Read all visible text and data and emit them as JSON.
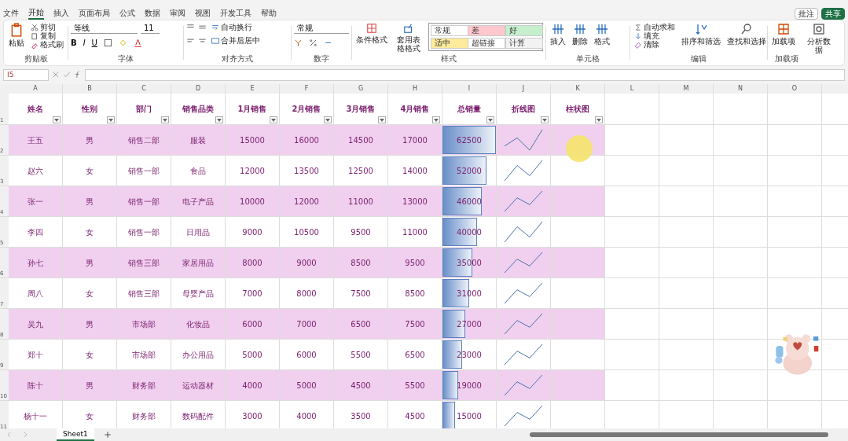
{
  "title_buttons": [
    "批注",
    "共享"
  ],
  "menu_tabs": [
    {
      "label": "文件",
      "selected": false
    },
    {
      "label": "开始",
      "selected": true
    },
    {
      "label": "插入",
      "selected": false
    },
    {
      "label": "页面布局",
      "selected": false
    },
    {
      "label": "公式",
      "selected": false
    },
    {
      "label": "数据",
      "selected": false
    },
    {
      "label": "审阅",
      "selected": false
    },
    {
      "label": "视图",
      "selected": false
    },
    {
      "label": "开发工具",
      "selected": false
    },
    {
      "label": "帮助",
      "selected": false
    }
  ],
  "ribbon": {
    "clipboard": {
      "paste": "粘贴",
      "cut": "剪切",
      "copy": "复制",
      "painter": "格式刷",
      "group": "剪贴板"
    },
    "font": {
      "name": "等线",
      "size": "11",
      "bold": "B",
      "italic": "I",
      "underline": "U",
      "group": "字体"
    },
    "alignment": {
      "wrap": "自动换行",
      "merge": "合并后居中",
      "group": "对齐方式"
    },
    "number": {
      "format": "常规",
      "group": "数字"
    },
    "styles": {
      "conditional": "条件格式",
      "table": "套用表格格式",
      "cells": [
        {
          "label": "常规",
          "color": "#ffffff"
        },
        {
          "label": "差",
          "color": "#ffc7ce"
        },
        {
          "label": "好",
          "color": "#c6efce"
        },
        {
          "label": "适中",
          "color": "#ffeb9c"
        },
        {
          "label": "超链接",
          "color": "#ffffff"
        },
        {
          "label": "计算",
          "color": "#f2f2f2"
        }
      ],
      "group": "样式"
    },
    "cells": {
      "insert": "插入",
      "delete": "删除",
      "format": "格式",
      "group": "单元格"
    },
    "editing": {
      "autosum": "自动求和",
      "fill": "填充",
      "clear": "清除",
      "sort": "排序和筛选",
      "find": "查找和选择",
      "group": "编辑"
    },
    "addins": {
      "label": "加载项",
      "group": "加载项"
    },
    "analyze": {
      "label": "分析数据"
    }
  },
  "name_box": "I5",
  "column_letters": [
    "A",
    "B",
    "C",
    "D",
    "E",
    "F",
    "G",
    "H",
    "I",
    "J",
    "K",
    "L",
    "M",
    "N",
    "O"
  ],
  "header_row_number": "1",
  "headers": [
    "姓名",
    "性别",
    "部门",
    "销售品类",
    "1月销售",
    "2月销售",
    "3月销售",
    "4月销售",
    "总销量",
    "折线图",
    "柱状图"
  ],
  "rows": [
    {
      "number": "2",
      "cells": [
        "王五",
        "男",
        "销售二部",
        "服装",
        "15000",
        "16000",
        "14500",
        "17000",
        "62500"
      ],
      "level": 1.0
    },
    {
      "number": "3",
      "cells": [
        "赵六",
        "女",
        "销售一部",
        "食品",
        "12000",
        "13500",
        "12500",
        "14000",
        "52000"
      ],
      "level": 0.83
    },
    {
      "number": "4",
      "cells": [
        "张一",
        "男",
        "销售一部",
        "电子产品",
        "10000",
        "12000",
        "11000",
        "13000",
        "46000"
      ],
      "level": 0.74
    },
    {
      "number": "5",
      "cells": [
        "李四",
        "女",
        "销售一部",
        "日用品",
        "9000",
        "10500",
        "9500",
        "11000",
        "40000"
      ],
      "level": 0.64
    },
    {
      "number": "6",
      "cells": [
        "孙七",
        "男",
        "销售三部",
        "家居用品",
        "8000",
        "9000",
        "8500",
        "9500",
        "35000"
      ],
      "level": 0.56
    },
    {
      "number": "7",
      "cells": [
        "周八",
        "女",
        "销售三部",
        "母婴产品",
        "7000",
        "8000",
        "7500",
        "8500",
        "31000"
      ],
      "level": 0.5
    },
    {
      "number": "8",
      "cells": [
        "吴九",
        "男",
        "市场部",
        "化妆品",
        "6000",
        "7000",
        "6500",
        "7500",
        "27000"
      ],
      "level": 0.43
    },
    {
      "number": "9",
      "cells": [
        "郑十",
        "女",
        "市场部",
        "办公用品",
        "5000",
        "6000",
        "5500",
        "6500",
        "23000"
      ],
      "level": 0.37
    },
    {
      "number": "10",
      "cells": [
        "陈十",
        "男",
        "财务部",
        "运动器材",
        "4000",
        "5000",
        "4500",
        "5500",
        "19000"
      ],
      "level": 0.3
    },
    {
      "number": "11",
      "cells": [
        "杨十一",
        "女",
        "财务部",
        "数码配件",
        "3000",
        "4000",
        "3500",
        "4500",
        "15000"
      ],
      "level": 0.24
    }
  ],
  "sheet_tabs": [
    {
      "label": "Sheet1",
      "selected": true
    }
  ]
}
